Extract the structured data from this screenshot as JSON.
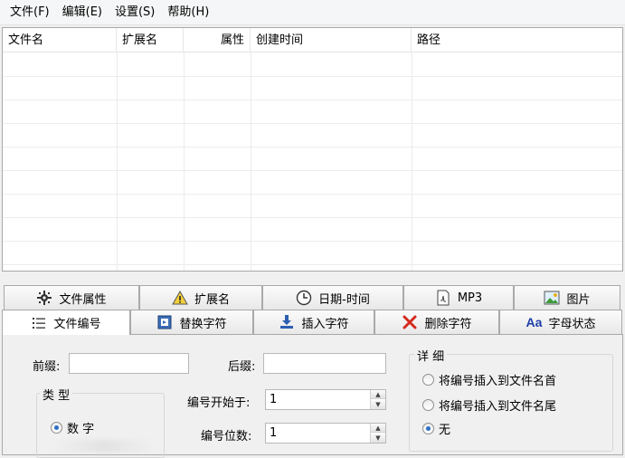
{
  "menu": [
    "文件(F)",
    "编辑(E)",
    "设置(S)",
    "帮助(H)"
  ],
  "list": {
    "columns": [
      "文件名",
      "扩展名",
      "属性",
      "创建时间",
      "路径"
    ]
  },
  "tabs_top": [
    {
      "label": "文件属性",
      "icon": "file-attributes-icon"
    },
    {
      "label": "扩展名",
      "icon": "extension-warning-icon"
    },
    {
      "label": "日期-时间",
      "icon": "clock-icon"
    },
    {
      "label": "MP3",
      "icon": "mp3-file-icon"
    },
    {
      "label": "图片",
      "icon": "picture-icon"
    }
  ],
  "tabs_bottom": [
    {
      "label": "文件编号",
      "icon": "numbered-list-icon",
      "active": true
    },
    {
      "label": "替换字符",
      "icon": "replace-icon"
    },
    {
      "label": "插入字符",
      "icon": "insert-arrow-icon"
    },
    {
      "label": "删除字符",
      "icon": "delete-x-icon"
    },
    {
      "label": "字母状态",
      "icon": "letter-case-icon",
      "icon_text": "Aa"
    }
  ],
  "panel": {
    "prefix_label": "前缀:",
    "suffix_label": "后缀:",
    "prefix_value": "",
    "suffix_value": "",
    "type_group_title": "类 型",
    "type_options": [
      {
        "label": "数 字",
        "selected": true
      }
    ],
    "start_label": "编号开始于:",
    "start_value": "1",
    "digits_label": "编号位数:",
    "digits_value": "1",
    "detail_group_title": "详 细",
    "detail_options": [
      {
        "label": "将编号插入到文件名首",
        "selected": false
      },
      {
        "label": "将编号插入到文件名尾",
        "selected": false
      },
      {
        "label": "无",
        "selected": true
      }
    ]
  },
  "colors": {
    "accent": "#2d6fc6",
    "delete_red": "#d42a1e",
    "letter_case_blue": "#1e3fa8"
  }
}
